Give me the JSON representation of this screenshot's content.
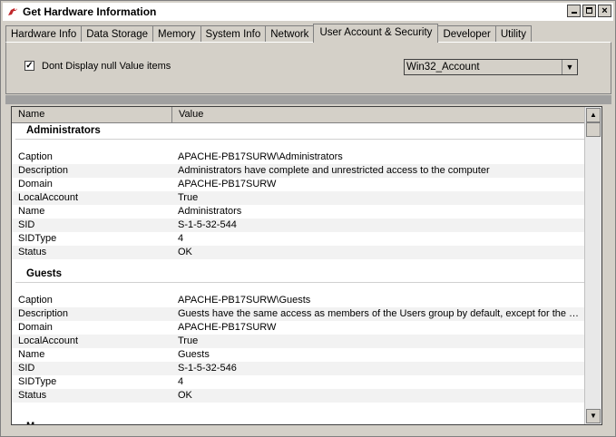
{
  "window": {
    "title": "Get Hardware Information",
    "close_label": "×"
  },
  "tabs": [
    {
      "label": "Hardware Info"
    },
    {
      "label": "Data Storage"
    },
    {
      "label": "Memory"
    },
    {
      "label": "System Info"
    },
    {
      "label": "Network"
    },
    {
      "label": "User Account & Security"
    },
    {
      "label": "Developer"
    },
    {
      "label": "Utility"
    }
  ],
  "active_tab": "User Account & Security",
  "options": {
    "null_checkbox_label": "Dont Display null Value items",
    "null_checkbox_checked": true,
    "null_checkbox_mark": "✓",
    "class_select_value": "Win32_Account",
    "class_select_arrow": "▼"
  },
  "grid": {
    "columns": {
      "name": "Name",
      "value": "Value"
    },
    "groups": [
      {
        "title": "Administrators",
        "rows": [
          {
            "k": "Caption",
            "v": "APACHE-PB17SURW\\Administrators"
          },
          {
            "k": "Description",
            "v": "Administrators have complete and unrestricted access to the computer"
          },
          {
            "k": "Domain",
            "v": "APACHE-PB17SURW"
          },
          {
            "k": "LocalAccount",
            "v": "True"
          },
          {
            "k": "Name",
            "v": "Administrators"
          },
          {
            "k": "SID",
            "v": "S-1-5-32-544"
          },
          {
            "k": "SIDType",
            "v": "4"
          },
          {
            "k": "Status",
            "v": "OK"
          }
        ]
      },
      {
        "title": "Guests",
        "rows": [
          {
            "k": "Caption",
            "v": "APACHE-PB17SURW\\Guests"
          },
          {
            "k": "Description",
            "v": "Guests have the same access as members of the Users group by default, except for the Gu..."
          },
          {
            "k": "Domain",
            "v": "APACHE-PB17SURW"
          },
          {
            "k": "LocalAccount",
            "v": "True"
          },
          {
            "k": "Name",
            "v": "Guests"
          },
          {
            "k": "SID",
            "v": "S-1-5-32-546"
          },
          {
            "k": "SIDType",
            "v": "4"
          },
          {
            "k": "Status",
            "v": "OK"
          }
        ]
      }
    ],
    "partial_next_group": "M",
    "scroll_up": "▲",
    "scroll_down": "▼"
  }
}
